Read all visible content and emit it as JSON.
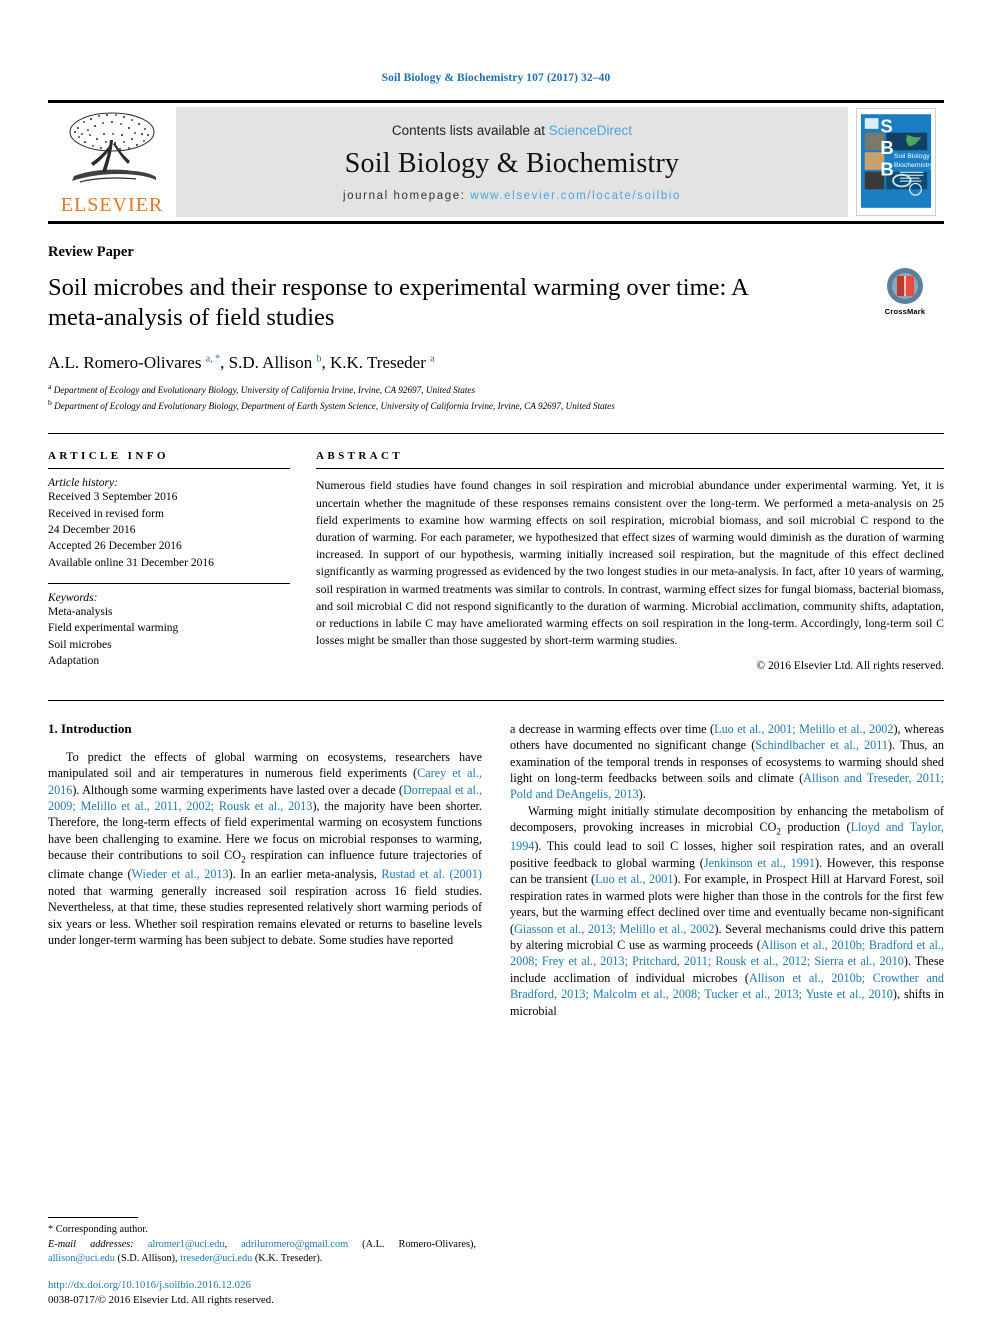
{
  "running_head": "Soil Biology & Biochemistry 107 (2017) 32–40",
  "masthead": {
    "elsevier_wordmark": "ELSEVIER",
    "contents_prefix": "Contents lists available at",
    "contents_link": "ScienceDirect",
    "journal_name": "Soil Biology & Biochemistry",
    "homepage_prefix": "journal homepage:",
    "homepage_url": "www.elsevier.com/locate/soilbio",
    "cover_letters": "SBB",
    "cover_title_line1": "Soil Biology &",
    "cover_title_line2": "Biochemistry",
    "colors": {
      "elsevier_orange": "#e87722",
      "link_blue": "#4aa3df",
      "masthead_gray": "#e3e3e3",
      "cover_blue": "#1b7ec2"
    }
  },
  "article": {
    "type": "Review Paper",
    "title": "Soil microbes and their response to experimental warming over time: A meta-analysis of field studies",
    "crossmark_label": "CrossMark",
    "authors_html": "A.L. Romero-Olivares <sup>a, *</sup>, S.D. Allison <sup>b</sup>, K.K. Treseder <sup>a</sup>",
    "affiliation_a": "Department of Ecology and Evolutionary Biology, University of California Irvine, Irvine, CA 92697, United States",
    "affiliation_b": "Department of Ecology and Evolutionary Biology, Department of Earth System Science, University of California Irvine, Irvine, CA 92697, United States"
  },
  "article_info": {
    "heading": "ARTICLE INFO",
    "history_label": "Article history:",
    "history": [
      "Received 3 September 2016",
      "Received in revised form",
      "24 December 2016",
      "Accepted 26 December 2016",
      "Available online 31 December 2016"
    ],
    "keywords_label": "Keywords:",
    "keywords": [
      "Meta-analysis",
      "Field experimental warming",
      "Soil microbes",
      "Adaptation"
    ]
  },
  "abstract": {
    "heading": "ABSTRACT",
    "text": "Numerous field studies have found changes in soil respiration and microbial abundance under experimental warming. Yet, it is uncertain whether the magnitude of these responses remains consistent over the long-term. We performed a meta-analysis on 25 field experiments to examine how warming effects on soil respiration, microbial biomass, and soil microbial C respond to the duration of warming. For each parameter, we hypothesized that effect sizes of warming would diminish as the duration of warming increased. In support of our hypothesis, warming initially increased soil respiration, but the magnitude of this effect declined significantly as warming progressed as evidenced by the two longest studies in our meta-analysis. In fact, after 10 years of warming, soil respiration in warmed treatments was similar to controls. In contrast, warming effect sizes for fungal biomass, bacterial biomass, and soil microbial C did not respond significantly to the duration of warming. Microbial acclimation, community shifts, adaptation, or reductions in labile C may have ameliorated warming effects on soil respiration in the long-term. Accordingly, long-term soil C losses might be smaller than those suggested by short-term warming studies.",
    "copyright": "© 2016 Elsevier Ltd. All rights reserved."
  },
  "introduction": {
    "section_number_title": "1. Introduction",
    "left_paragraph_1": "To predict the effects of global warming on ecosystems, researchers have manipulated soil and air temperatures in numerous field experiments (Carey et al., 2016). Although some warming experiments have lasted over a decade (Dorrepaal et al., 2009; Melillo et al., 2011, 2002; Rousk et al., 2013), the majority have been shorter. Therefore, the long-term effects of field experimental warming on ecosystem functions have been challenging to examine. Here we focus on microbial responses to warming, because their contributions to soil CO2 respiration can influence future trajectories of climate change (Wieder et al., 2013). In an earlier meta-analysis, Rustad et al. (2001) noted that warming generally increased soil respiration across 16 field studies. Nevertheless, at that time, these studies represented relatively short warming periods of six years or less. Whether soil respiration remains elevated or returns to baseline levels under longer-term warming has been subject to debate. Some studies have reported",
    "right_paragraph_1": "a decrease in warming effects over time (Luo et al., 2001; Melillo et al., 2002), whereas others have documented no significant change (Schindlbacher et al., 2011). Thus, an examination of the temporal trends in responses of ecosystems to warming should shed light on long-term feedbacks between soils and climate (Allison and Treseder, 2011; Pold and DeAngelis, 2013).",
    "right_paragraph_2": "Warming might initially stimulate decomposition by enhancing the metabolism of decomposers, provoking increases in microbial CO2 production (Lloyd and Taylor, 1994). This could lead to soil C losses, higher soil respiration rates, and an overall positive feedback to global warming (Jenkinson et al., 1991). However, this response can be transient (Luo et al., 2001). For example, in Prospect Hill at Harvard Forest, soil respiration rates in warmed plots were higher than those in the controls for the first few years, but the warming effect declined over time and eventually became non-significant (Giasson et al., 2013; Melillo et al., 2002). Several mechanisms could drive this pattern by altering microbial C use as warming proceeds (Allison et al., 2010b; Bradford et al., 2008; Frey et al., 2013; Pritchard, 2011; Rousk et al., 2012; Sierra et al., 2010). These include acclimation of individual microbes (Allison et al., 2010b; Crowther and Bradford, 2013; Malcolm et al., 2008; Tucker et al., 2013; Yuste et al., 2010), shifts in microbial"
  },
  "footnote": {
    "corresponding": "* Corresponding author.",
    "email_label": "E-mail addresses:",
    "emails_html": "alromer1@uci.edu, adriluromero@gmail.com (A.L. Romero-Olivares), allison@uci.edu (S.D. Allison), treseder@uci.edu (K.K. Treseder)."
  },
  "footer": {
    "doi": "http://dx.doi.org/10.1016/j.soilbio.2016.12.026",
    "issn_line": "0038-0717/© 2016 Elsevier Ltd. All rights reserved."
  }
}
